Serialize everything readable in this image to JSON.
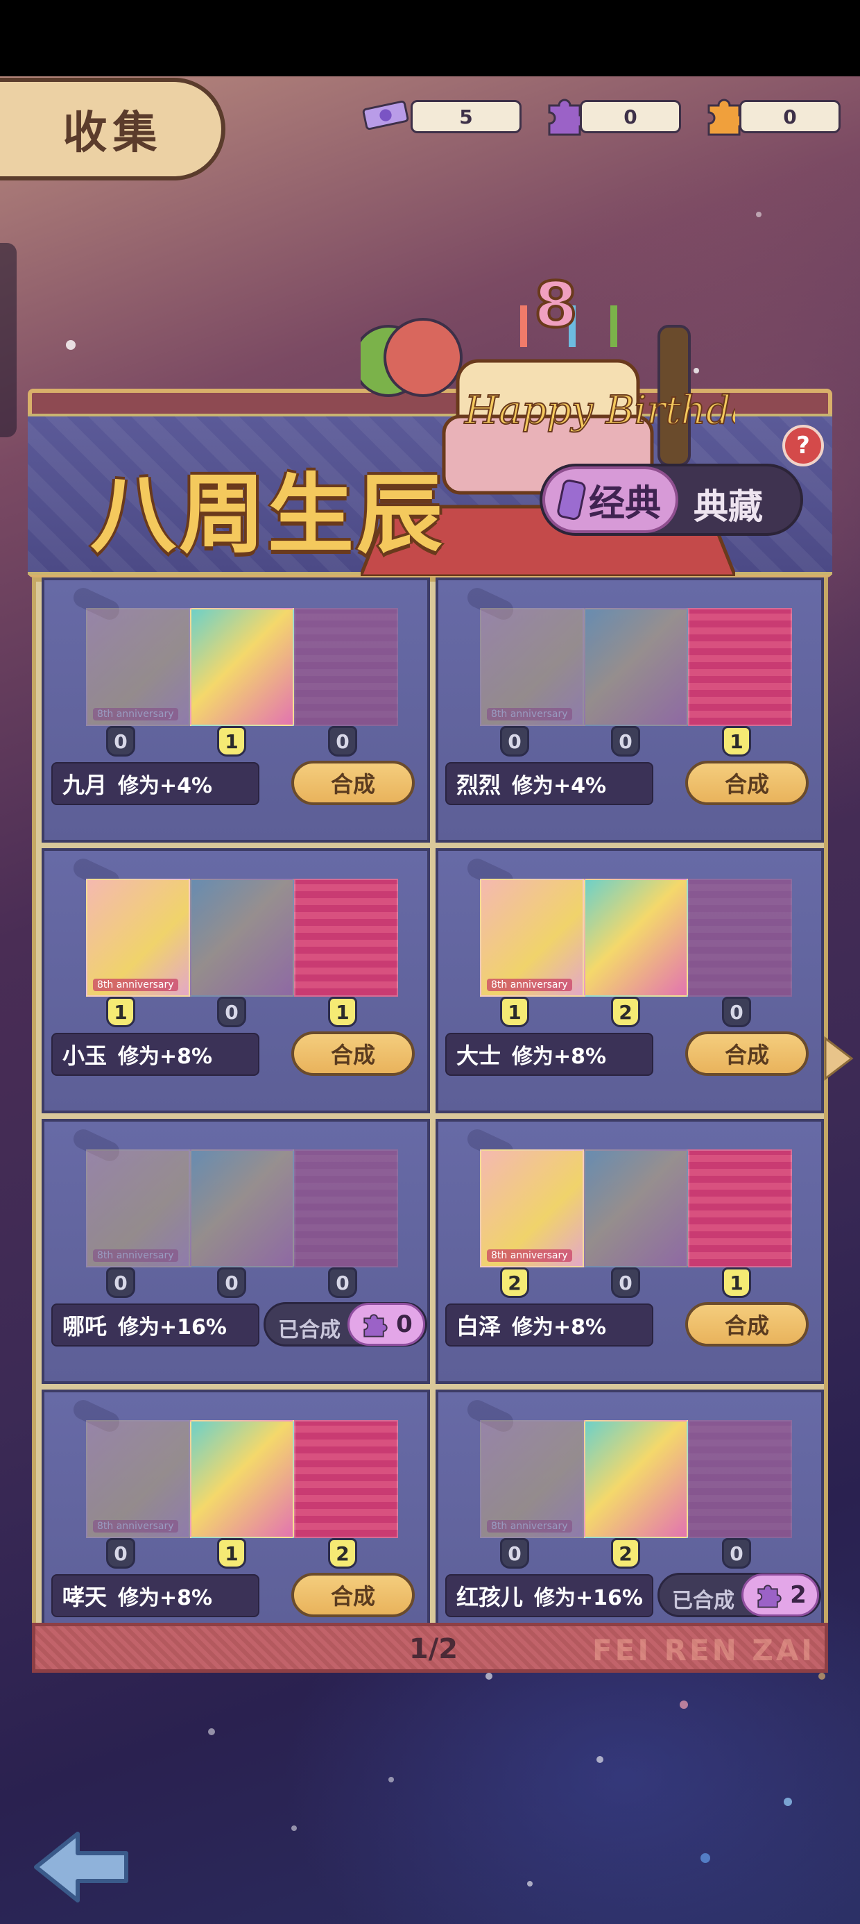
{
  "header": {
    "collect_label": "收集",
    "resources": [
      {
        "icon": "ticket-icon",
        "value": "5",
        "color": "#8a6ad0"
      },
      {
        "icon": "purple-puzzle-icon",
        "value": "0",
        "color": "#9b62c7"
      },
      {
        "icon": "orange-puzzle-icon",
        "value": "0",
        "color": "#f0a03c"
      }
    ]
  },
  "banner": {
    "title": "八周生辰",
    "toggle_active": "经典",
    "toggle_inactive": "典藏",
    "help": "?",
    "cake_number": "8",
    "cake_text": "Happy Birthday"
  },
  "cards": [
    {
      "name": "九月",
      "bonus": "修为+4%",
      "counts": [
        "0",
        "1",
        "0"
      ],
      "owned": [
        false,
        true,
        false
      ],
      "action": "合成",
      "state": "synth"
    },
    {
      "name": "烈烈",
      "bonus": "修为+4%",
      "counts": [
        "0",
        "0",
        "1"
      ],
      "owned": [
        false,
        false,
        true
      ],
      "action": "合成",
      "state": "synth"
    },
    {
      "name": "小玉",
      "bonus": "修为+8%",
      "counts": [
        "1",
        "0",
        "1"
      ],
      "owned": [
        true,
        false,
        true
      ],
      "action": "合成",
      "state": "synth"
    },
    {
      "name": "大士",
      "bonus": "修为+8%",
      "counts": [
        "1",
        "2",
        "0"
      ],
      "owned": [
        true,
        true,
        false
      ],
      "action": "合成",
      "state": "synth"
    },
    {
      "name": "哪吒",
      "bonus": "修为+16%",
      "counts": [
        "0",
        "0",
        "0"
      ],
      "owned": [
        false,
        false,
        false
      ],
      "action": "已合成",
      "state": "done",
      "done_count": "0"
    },
    {
      "name": "白泽",
      "bonus": "修为+8%",
      "counts": [
        "2",
        "0",
        "1"
      ],
      "owned": [
        true,
        false,
        true
      ],
      "action": "合成",
      "state": "synth"
    },
    {
      "name": "哮天",
      "bonus": "修为+8%",
      "counts": [
        "0",
        "1",
        "2"
      ],
      "owned": [
        false,
        true,
        true
      ],
      "action": "合成",
      "state": "synth"
    },
    {
      "name": "红孩儿",
      "bonus": "修为+16%",
      "counts": [
        "0",
        "2",
        "0"
      ],
      "owned": [
        false,
        true,
        false
      ],
      "action": "已合成",
      "state": "done",
      "done_count": "2"
    }
  ],
  "card_label": "8th anniversary",
  "pager": {
    "text": "1/2",
    "brand": "FEI REN ZAI"
  },
  "nav": {
    "back": "back-arrow-icon",
    "next": "next-arrow-icon"
  }
}
